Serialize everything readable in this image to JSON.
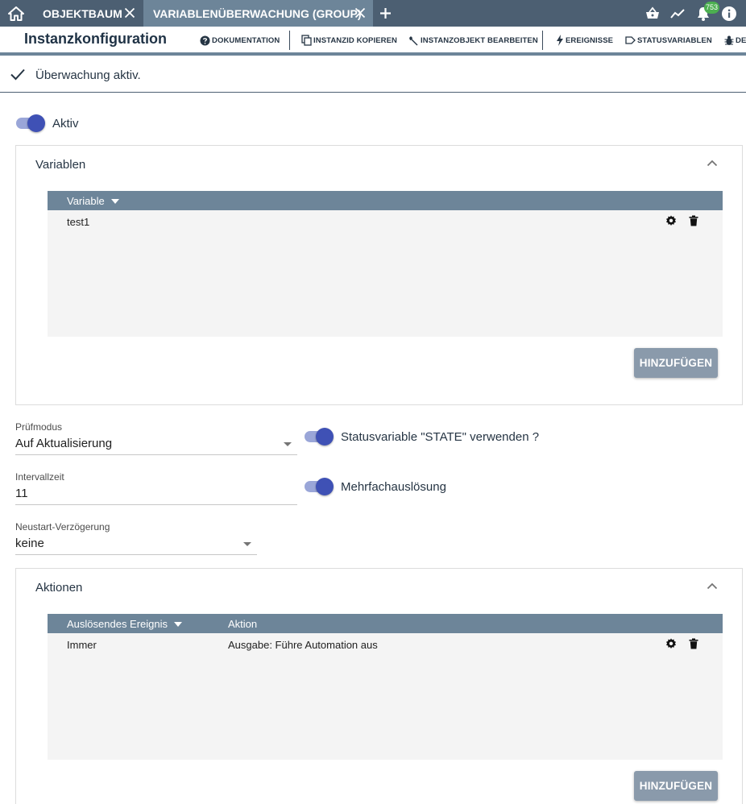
{
  "tabs": [
    {
      "label": "OBJEKTBAUM",
      "active": false
    },
    {
      "label": "VARIABLENÜBERWACHUNG (GROUP)",
      "active": true
    }
  ],
  "notifications": {
    "count": "753"
  },
  "toolbar": {
    "title": "Instanzkonfiguration",
    "buttons": [
      {
        "label": "DOKUMENTATION",
        "icon": "help-circle-icon"
      },
      {
        "label": "INSTANZID KOPIEREN",
        "icon": "copy-icon"
      },
      {
        "label": "INSTANZOBJEKT BEARBEITEN",
        "icon": "wrench-icon"
      },
      {
        "label": "EREIGNISSE",
        "icon": "lightning-icon"
      },
      {
        "label": "STATUSVARIABLEN",
        "icon": "tag-icon"
      },
      {
        "label": "DE",
        "icon": "bug-icon"
      }
    ]
  },
  "status": {
    "text": "Überwachung aktiv."
  },
  "active_switch": {
    "label": "Aktiv",
    "checked": true
  },
  "variables_panel": {
    "title": "Variablen",
    "column": "Variable",
    "rows": [
      {
        "name": "test1"
      }
    ],
    "add_label": "HINZUFÜGEN"
  },
  "form": {
    "pruefmodus": {
      "label": "Prüfmodus",
      "value": "Auf Aktualisierung"
    },
    "intervallzeit": {
      "label": "Intervallzeit",
      "value": "11"
    },
    "neustart": {
      "label": "Neustart-Verzögerung",
      "value": "keine"
    },
    "state_switch": {
      "label": "Statusvariable \"STATE\" verwenden ?",
      "checked": true
    },
    "multi_switch": {
      "label": "Mehrfachauslösung",
      "checked": true
    }
  },
  "actions_panel": {
    "title": "Aktionen",
    "columns": [
      "Auslösendes Ereignis",
      "Aktion"
    ],
    "rows": [
      {
        "event": "Immer",
        "action": "Ausgabe: Führe Automation aus"
      }
    ],
    "add_label": "HINZUFÜGEN"
  },
  "colors": {
    "header": "#4c5f72",
    "active_tab": "#6d8599",
    "accent": "#3f51b5",
    "button": "#8a9aab",
    "badge": "#4caf50"
  }
}
